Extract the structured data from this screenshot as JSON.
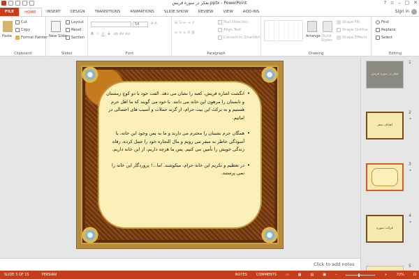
{
  "title": "تفکر در سوره قریش.pptx - PowerPoint",
  "window": {
    "help": "?",
    "restore": "▫",
    "minimize": "–",
    "maximize": "□",
    "close": "✕"
  },
  "user": {
    "signin": "Sign in"
  },
  "tabs": [
    "FILE",
    "HOME",
    "INSERT",
    "DESIGN",
    "TRANSITIONS",
    "ANIMATIONS",
    "SLIDE SHOW",
    "REVIEW",
    "VIEW",
    "ADD-INS"
  ],
  "ribbon": {
    "clipboard": {
      "label": "Clipboard",
      "paste": "Paste",
      "cut": "Cut",
      "copy": "Copy",
      "format_painter": "Format Painter"
    },
    "slides": {
      "label": "Slides",
      "new_slide": "New Slide",
      "layout": "Layout",
      "reset": "Reset",
      "section": "Section"
    },
    "font": {
      "label": "Font",
      "size": "54"
    },
    "paragraph": {
      "label": "Paragraph",
      "text_direction": "Text Direction",
      "align_text": "Align Text",
      "convert": "Convert to SmartArt"
    },
    "drawing": {
      "label": "Drawing",
      "arrange": "Arrange",
      "quick_styles": "Quick Styles",
      "shape_fill": "Shape Fill",
      "shape_outline": "Shape Outline",
      "shape_effects": "Shape Effects"
    },
    "editing": {
      "label": "Editing",
      "find": "Find",
      "replace": "Replace",
      "select": "Select"
    }
  },
  "thumbnails": [
    {
      "num": "1",
      "text": "تفکر در سوره قریش",
      "star": ""
    },
    {
      "num": "2",
      "text": "اهداف سفر",
      "star": "*"
    },
    {
      "num": "3",
      "text": "",
      "star": "*"
    },
    {
      "num": "4",
      "text": "قرائت سوره",
      "star": "*"
    },
    {
      "num": "5",
      "text": "",
      "star": ""
    }
  ],
  "slide": {
    "paragraphs": [
      "انگشت اشاره قریش، کعبه را نشان می دهد. الفت خود با دو کوچ زمستان و تابستان را مرهون این خانه می دانند. با خود می گویند که ما اهل حرم هستیم و به برکت این بیت حرام، از گزند حملات و آسیب های احتمالی در امانیم.",
      "همگان حرم نشینان را محترم می دارند و ما به یمن وجود این خانه، با آسودگی خاطر به سفر می رویم و مال التجاره خود را حمل کرده، رفاه زندگی خویش را تأمین می کنیم. پس ما هرچه داریم، از این خانه داریم.",
      "در تعظیم و تکریم این خانه حرام، میکوشند. اما...! پروردگار این خانه را نمی پرستند."
    ]
  },
  "notes": {
    "placeholder": "Click to add notes"
  },
  "status": {
    "slide": "SLIDE 3 OF 15",
    "language": "PERSIAN",
    "notes": "NOTES",
    "comments": "COMMENTS",
    "zoom": "70%"
  }
}
